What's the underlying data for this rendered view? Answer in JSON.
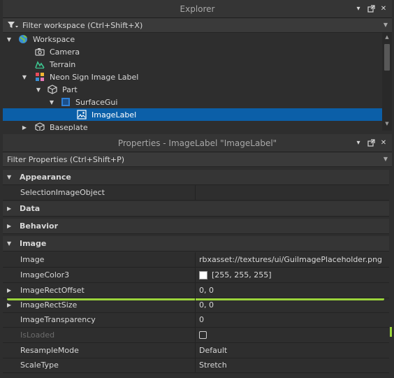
{
  "explorer": {
    "title": "Explorer",
    "filter_placeholder": "Filter workspace (Ctrl+Shift+X)",
    "items": [
      {
        "label": "Workspace",
        "depth": 0,
        "expanded": true,
        "icon": "globe-icon"
      },
      {
        "label": "Camera",
        "depth": 1,
        "icon": "camera-icon"
      },
      {
        "label": "Terrain",
        "depth": 1,
        "icon": "terrain-icon"
      },
      {
        "label": "Neon Sign Image Label",
        "depth": 1,
        "expanded": true,
        "icon": "model-icon"
      },
      {
        "label": "Part",
        "depth": 2,
        "expanded": true,
        "icon": "part-icon"
      },
      {
        "label": "SurfaceGui",
        "depth": 3,
        "expanded": true,
        "icon": "surfacegui-icon"
      },
      {
        "label": "ImageLabel",
        "depth": 4,
        "selected": true,
        "icon": "imagelabel-icon"
      },
      {
        "label": "Baseplate",
        "depth": 1,
        "expanded": false,
        "icon": "part-icon"
      }
    ]
  },
  "properties": {
    "title": "Properties - ImageLabel \"ImageLabel\"",
    "filter_placeholder": "Filter Properties (Ctrl+Shift+P)",
    "rows": [
      {
        "type": "category",
        "label": "Appearance",
        "expanded": true
      },
      {
        "type": "prop",
        "label": "SelectionImageObject",
        "value": ""
      },
      {
        "type": "category",
        "label": "Data",
        "expanded": false
      },
      {
        "type": "category",
        "label": "Behavior",
        "expanded": false
      },
      {
        "type": "category",
        "label": "Image",
        "expanded": true
      },
      {
        "type": "prop",
        "label": "Image",
        "value": "rbxasset://textures/ui/GuiImagePlaceholder.png"
      },
      {
        "type": "prop",
        "label": "ImageColor3",
        "value": "[255, 255, 255]"
      },
      {
        "type": "prop",
        "label": "ImageRectOffset",
        "value": "0, 0"
      },
      {
        "type": "prop",
        "label": "ImageRectSize",
        "value": "0, 0"
      },
      {
        "type": "prop",
        "label": "ImageTransparency",
        "value": "0"
      },
      {
        "type": "prop",
        "label": "IsLoaded",
        "value": ""
      },
      {
        "type": "prop",
        "label": "ResampleMode",
        "value": "Default"
      },
      {
        "type": "prop",
        "label": "ScaleType",
        "value": "Stretch"
      }
    ]
  },
  "colors": {
    "selection": "#0b5fa8",
    "highlight": "#9bd43c",
    "background": "#2e2e2e"
  }
}
